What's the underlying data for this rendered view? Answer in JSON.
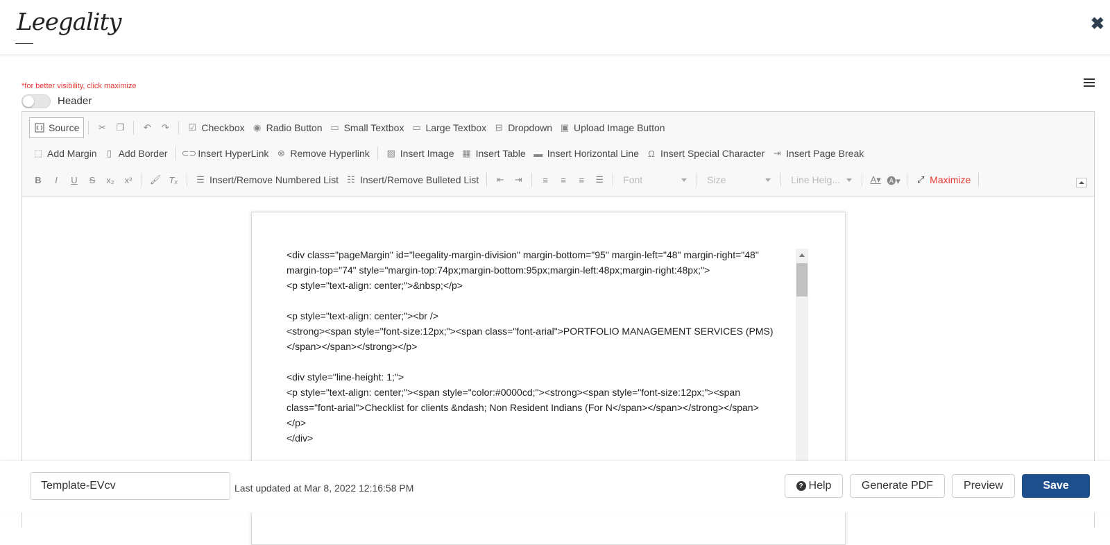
{
  "brand": {
    "logo_text": "Leegality"
  },
  "hint": "*for better visibility, click maximize",
  "header_toggle_label": "Header",
  "toolbar": {
    "source": "Source",
    "checkbox": "Checkbox",
    "radio_button": "Radio Button",
    "small_textbox": "Small Textbox",
    "large_textbox": "Large Textbox",
    "dropdown": "Dropdown",
    "upload_image_button": "Upload Image Button",
    "add_margin": "Add Margin",
    "add_border": "Add Border",
    "insert_hyperlink": "Insert HyperLink",
    "remove_hyperlink": "Remove Hyperlink",
    "insert_image": "Insert Image",
    "insert_table": "Insert Table",
    "insert_horizontal_line": "Insert Horizontal Line",
    "insert_special_character": "Insert Special Character",
    "insert_page_break": "Insert Page Break",
    "numbered_list": "Insert/Remove Numbered List",
    "bulleted_list": "Insert/Remove Bulleted List",
    "font": "Font",
    "size": "Size",
    "line_height": "Line Heig...",
    "maximize": "Maximize"
  },
  "source_content": "<div class=\"pageMargin\" id=\"leegality-margin-division\" margin-bottom=\"95\" margin-left=\"48\" margin-right=\"48\" margin-top=\"74\" style=\"margin-top:74px;margin-bottom:95px;margin-left:48px;margin-right:48px;\">\n<p style=\"text-align: center;\">&nbsp;</p>\n\n<p style=\"text-align: center;\"><br />\n<strong><span style=\"font-size:12px;\"><span class=\"font-arial\">PORTFOLIO MANAGEMENT SERVICES (PMS)</span></span></strong></p>\n\n<div style=\"line-height: 1;\">\n<p style=\"text-align: center;\"><span style=\"color:#0000cd;\"><strong><span style=\"font-size:12px;\"><span class=\"font-arial\">Checklist for clients &ndash; Non Resident Indians (For N</span></span></strong></span>\n</p>\n</div>",
  "footer": {
    "template_name": "Template-EVcv",
    "last_updated": "Last updated at Mar 8, 2022 12:16:58 PM",
    "help": "Help",
    "generate_pdf": "Generate PDF",
    "preview": "Preview",
    "save": "Save"
  },
  "colors": {
    "primary": "#1d4f8c",
    "hint_red": "#e53935",
    "maximize_red": "#e53935"
  }
}
